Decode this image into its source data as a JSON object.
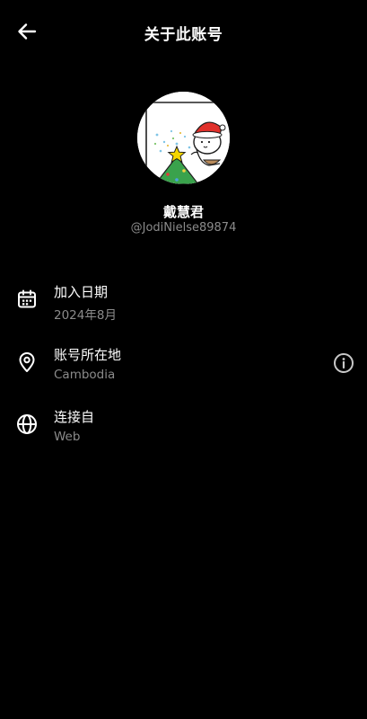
{
  "header": {
    "title": "关于此账号",
    "back_icon": "arrow-left-icon"
  },
  "profile": {
    "display_name": "戴慧君",
    "handle": "@JodiNielse89874"
  },
  "rows": [
    {
      "icon": "calendar-icon",
      "label": "加入日期",
      "value": "2024年8月"
    },
    {
      "icon": "location-pin-icon",
      "label": "账号所在地",
      "value": "Cambodia",
      "action_icon": "info-icon"
    },
    {
      "icon": "globe-icon",
      "label": "连接自",
      "value": "Web"
    }
  ],
  "colors": {
    "background": "#000000",
    "text_primary": "#ffffff",
    "text_secondary": "#8b8b8b"
  }
}
